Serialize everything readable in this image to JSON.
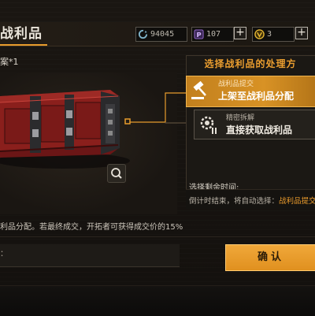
{
  "header": {
    "title": "战利品",
    "currencies": [
      {
        "icon": "refresh-currency-icon",
        "value": "94045",
        "color": "#7fb3c9"
      },
      {
        "icon": "purple-p-currency-icon",
        "value": "107",
        "color": "#9a6bd3"
      },
      {
        "icon": "gold-v-currency-icon",
        "value": "3",
        "color": "#e3b532"
      }
    ],
    "plus_label": "+"
  },
  "item": {
    "name": "案*1"
  },
  "choice": {
    "header": "选择战利品的处理方",
    "options": [
      {
        "sub": "战利品提交",
        "main": "上架至战利品分配",
        "icon": "gavel-icon",
        "selected": true
      },
      {
        "sub": "精密拆解",
        "main": "直接获取战利品",
        "icon": "disassemble-gears-icon",
        "selected": false
      }
    ],
    "time_label": "选择剩余时间:",
    "countdown_prefix": "倒计时结束，将自动选择：",
    "countdown_highlight": "战利品提交"
  },
  "description": "利品分配。若最终成交，开拓者可获得成交价的15%",
  "input": {
    "label": "："
  },
  "confirm": {
    "label": "确认"
  },
  "colors": {
    "accent": "#e79b2c",
    "background": "#1a1612"
  }
}
